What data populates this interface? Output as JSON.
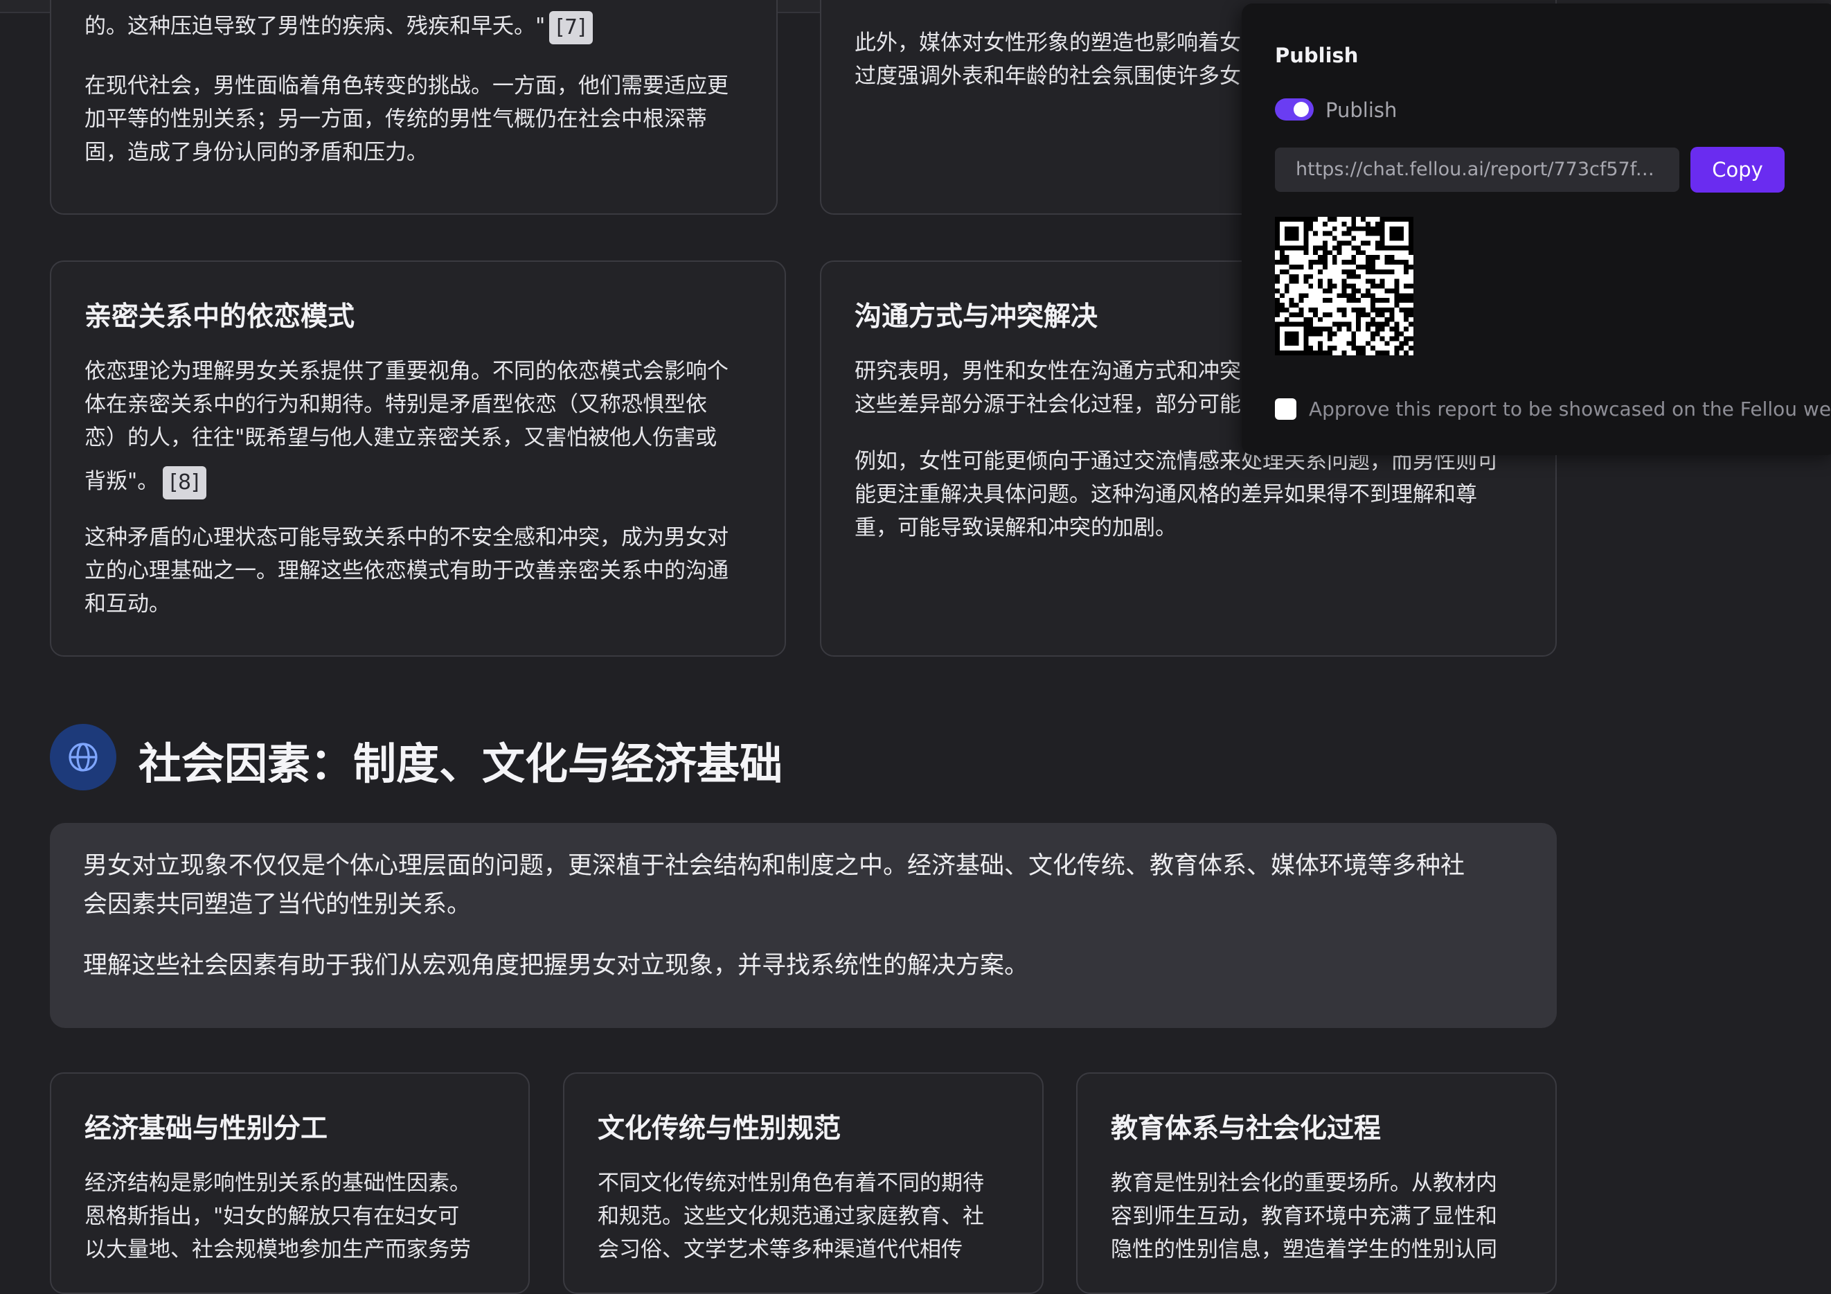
{
  "cards_top": {
    "left": {
      "lines_1": [
        "的。这种压迫导致了男性的疾病、残疾和早夭。\""
      ],
      "cite_1": "[7]",
      "lines_2": [
        "在现代社会，男性面临着角色转变的挑战。一方面，他们需要适应更",
        "加平等的性别关系；另一方面，传统的男性气概仍在社会中根深蒂",
        "固，造成了身份认同的矛盾和压力。"
      ]
    },
    "right": {
      "lines": [
        "此外，媒体对女性形象的塑造也影响着女",
        "过度强调外表和年龄的社会氛围使许多女"
      ]
    }
  },
  "cards_middle": {
    "left": {
      "title": "亲密关系中的依恋模式",
      "lines_1": [
        "依恋理论为理解男女关系提供了重要视角。不同的依恋模式会影响个",
        "体在亲密关系中的行为和期待。特别是矛盾型依恋（又称恐惧型依",
        "恋）的人，往往\"既希望与他人建立亲密关系，又害怕被他人伤害或"
      ],
      "last_line": "背叛\"。",
      "cite": "[8]",
      "lines_2": [
        "这种矛盾的心理状态可能导致关系中的不安全感和冲突，成为男女对",
        "立的心理基础之一。理解这些依恋模式有助于改善亲密关系中的沟通",
        "和互动。"
      ]
    },
    "right": {
      "title": "沟通方式与冲突解决",
      "lines_1": [
        "研究表明，男性和女性在沟通方式和冲突",
        "这些差异部分源于社会化过程，部分可能"
      ],
      "lines_2": [
        "例如，女性可能更倾向于通过交流情感来处理关系问题，而男性则可",
        "能更注重解决具体问题。这种沟通风格的差异如果得不到理解和尊",
        "重，可能导致误解和冲突的加剧。"
      ]
    }
  },
  "section": {
    "title": "社会因素：制度、文化与经济基础",
    "icon": "globe-icon",
    "intro_1": [
      "男女对立现象不仅仅是个体心理层面的问题，更深植于社会结构和制度之中。经济基础、文化传统、教育体系、媒体环境等多种社",
      "会因素共同塑造了当代的性别关系。"
    ],
    "intro_2": "理解这些社会因素有助于我们从宏观角度把握男女对立现象，并寻找系统性的解决方案。"
  },
  "cards_bottom": [
    {
      "title": "经济基础与性别分工",
      "lines": [
        "经济结构是影响性别关系的基础性因素。",
        "恩格斯指出，\"妇女的解放只有在妇女可",
        "以大量地、社会规模地参加生产而家务劳"
      ]
    },
    {
      "title": "文化传统与性别规范",
      "lines": [
        "不同文化传统对性别角色有着不同的期待",
        "和规范。这些文化规范通过家庭教育、社",
        "会习俗、文学艺术等多种渠道代代相传"
      ]
    },
    {
      "title": "教育体系与社会化过程",
      "lines": [
        "教育是性别社会化的重要场所。从教材内",
        "容到师生互动，教育环境中充满了显性和",
        "隐性的性别信息，塑造着学生的性别认同"
      ]
    }
  ],
  "publish": {
    "title": "Publish",
    "toggle_label": "Publish",
    "toggle_on": true,
    "url": "https://chat.fellou.ai/report/773cf57f-1...",
    "copy_label": "Copy",
    "checkbox_label": "Approve this report to be showcased on the Fellou website",
    "checkbox_checked": false
  },
  "colors": {
    "accent": "#6a2cf0",
    "background": "#202024",
    "card": "#232327",
    "section_icon_bg": "#1d3a7a"
  }
}
